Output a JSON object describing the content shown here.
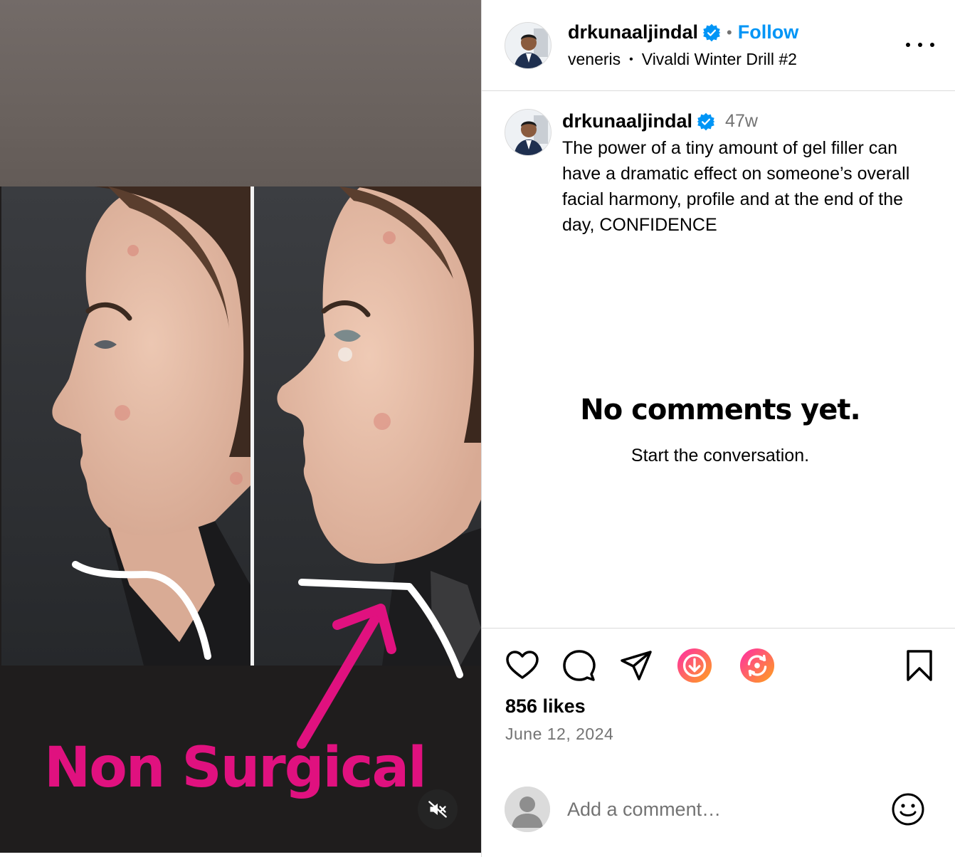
{
  "media": {
    "caption_text": "Non Surgical",
    "mute_icon": "speaker-muted-icon",
    "colors": {
      "caption": "#e0117f",
      "background": "#1f1d1d"
    }
  },
  "header": {
    "username": "drkunaaljindal",
    "verified_icon": "verified-badge-icon",
    "separator": "•",
    "follow_label": "Follow",
    "audio_artist": "veneris",
    "audio_bullet": "•",
    "audio_track": "Vivaldi Winter Drill #2",
    "more_icon": "more-options-icon"
  },
  "caption": {
    "username": "drkunaaljindal",
    "time": "47w",
    "text": "The power of a tiny amount of gel filler can have a dramatic effect on someone’s overall facial harmony, profile and at the end of the day, CONFIDENCE"
  },
  "comments": {
    "empty_title": "No comments yet.",
    "empty_subtitle": "Start the conversation."
  },
  "actions": {
    "icons": [
      "heart-icon",
      "comment-icon",
      "share-icon",
      "download-icon",
      "repost-icon",
      "bookmark-icon"
    ]
  },
  "stats": {
    "likes": "856 likes",
    "date": "June 12, 2024"
  },
  "comment_box": {
    "placeholder": "Add a comment…",
    "emoji_icon": "emoji-icon"
  },
  "colors": {
    "link_blue": "#0095f6",
    "muted_text": "#737373",
    "border": "#dbdbdb",
    "verified_blue": "#0095f6"
  }
}
